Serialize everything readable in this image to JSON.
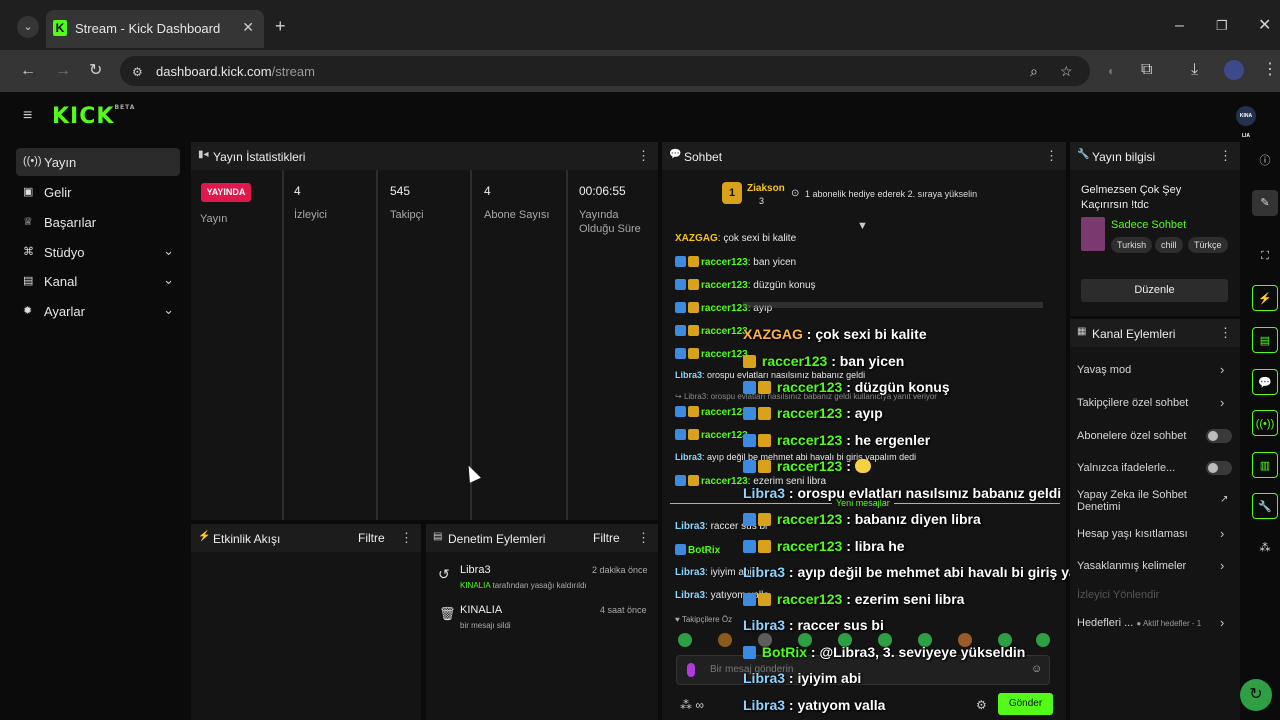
{
  "browser": {
    "tab_title": "Stream - Kick Dashboard",
    "url_host": "dashboard.kick.com",
    "url_path": "/stream"
  },
  "header": {
    "logo": "KICK",
    "logo_tag": "BETA",
    "avatar": "KINA LIA"
  },
  "sidebar": {
    "items": [
      {
        "label": "Yayın",
        "icon": "broadcast-icon"
      },
      {
        "label": "Gelir",
        "icon": "money-icon"
      },
      {
        "label": "Başarılar",
        "icon": "trophy-icon"
      },
      {
        "label": "Stüdyo",
        "icon": "studio-icon"
      },
      {
        "label": "Kanal",
        "icon": "channel-icon"
      },
      {
        "label": "Ayarlar",
        "icon": "gear-icon"
      }
    ]
  },
  "stats": {
    "title": "Yayın İstatistikleri",
    "live_badge": "YAYINDA",
    "live_label": "Yayın",
    "viewers_value": "4",
    "viewers_label": "İzleyici",
    "followers_value": "545",
    "followers_label": "Takipçi",
    "subs_value": "4",
    "subs_label": "Abone Sayısı",
    "uptime_value": "00:06:55",
    "uptime_label_1": "Yayında",
    "uptime_label_2": "Olduğu Süre"
  },
  "activity": {
    "title": "Etkinlik Akışı",
    "filter": "Filtre"
  },
  "moderation": {
    "title": "Denetim Eylemleri",
    "filter": "Filtre",
    "items": [
      {
        "user": "Libra3",
        "time": "2 dakika önce",
        "actor": "KINALIA",
        "desc": " tarafından yasağı kaldırıldı"
      },
      {
        "user": "KINALIA",
        "time": "4 saat önce",
        "desc": "bir mesajı sildi"
      }
    ]
  },
  "chat": {
    "title": "Sohbet",
    "pinned_user": "Ziakson",
    "pinned_rank": "1",
    "pinned_count": "3",
    "pinned_text": "1 abonelik hediye ederek 2. sıraya yükselin",
    "lines": [
      {
        "user": "XAZGAG",
        "text": ": çok sexi bi kalite"
      },
      {
        "user": "raccer123",
        "text": ": ban yicen"
      },
      {
        "user": "raccer123",
        "text": ": düzgün konuş"
      },
      {
        "user": "raccer123",
        "text": ": ayıp"
      },
      {
        "user": "raccer123",
        "text": ": he ergenler"
      },
      {
        "user": "raccer123",
        "text": ":"
      },
      {
        "user": "Libra3",
        "text": ": orospu evlatları nasılsınız babanız geldi"
      },
      {
        "user": "Libra3",
        "text": ": orospu evlatları nasılsınız babanız geldi kullanıcıya yanıt veriyor"
      },
      {
        "user": "raccer123",
        "text": ": babanız diyen libra"
      },
      {
        "user": "raccer123",
        "text": ": libra he"
      },
      {
        "user": "Libra3",
        "text": ": ayıp değil be mehmet abi havalı bi giriş yapalım dedi"
      },
      {
        "user": "raccer123",
        "text": ": ezerim seni libra"
      },
      {
        "user": "Libra3",
        "text": ": raccer sus bi"
      },
      {
        "user": "BotRix",
        "text": ": @Libra3, 3. seviyeye yükseldin"
      },
      {
        "user": "Libra3",
        "text": ": iyiyim abi"
      },
      {
        "user": "Libra3",
        "text": ": yatıyom valla"
      }
    ],
    "new_messages": "Yeni mesajlar",
    "followers_only": "Takipçilere Öz",
    "input_placeholder": "Bir mesaj gönderin",
    "send": "Gönder"
  },
  "stream_info": {
    "title": "Yayın bilgisi",
    "stream_title": "Gelmezsen Çok Şey Kaçırırsın !tdc",
    "category": "Sadece Sohbet",
    "tags": [
      "Turkish",
      "chill",
      "Türkçe"
    ],
    "edit": "Düzenle"
  },
  "channel_actions": {
    "title": "Kanal Eylemleri",
    "items": [
      {
        "label": "Yavaş mod",
        "control": "chevron"
      },
      {
        "label": "Takipçilere özel sohbet",
        "control": "chevron"
      },
      {
        "label": "Abonelere özel sohbet",
        "control": "toggle"
      },
      {
        "label": "Yalnızca ifadelerle...",
        "control": "toggle"
      },
      {
        "label": "Yapay Zeka ile Sohbet",
        "label2": "Denetimi",
        "control": "external"
      },
      {
        "label": "Hesap yaşı kısıtlaması",
        "control": "chevron"
      },
      {
        "label": "Yasaklanmış kelimeler",
        "control": "chevron"
      },
      {
        "label": "İzleyici Yönlendir",
        "control": "none"
      },
      {
        "label": "Hedefleri ...",
        "sub": "Aktif hedefler - 1",
        "control": "chevron"
      }
    ]
  },
  "colors": {
    "brand": "#53fc18",
    "live": "#e0184b"
  }
}
